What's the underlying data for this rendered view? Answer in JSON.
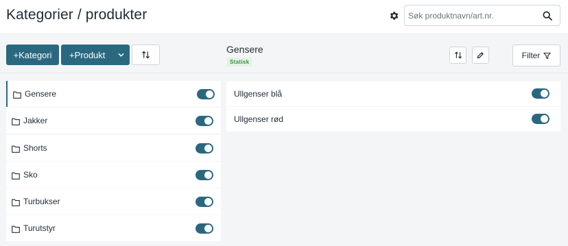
{
  "header": {
    "title": "Kategorier / produkter",
    "settings_icon": "gear-icon",
    "search": {
      "placeholder": "Søk produktnavn/art.nr.",
      "value": "",
      "icon": "search-icon"
    }
  },
  "toolbar": {
    "add_category_label": "+Kategori",
    "add_product_label": "+Produkt",
    "sort_icon": "sort-arrows-icon",
    "selected_category": {
      "name": "Gensere",
      "badge": "Statisk"
    },
    "edit_icon": "pencil-icon",
    "filter_label": "Filter",
    "filter_icon": "funnel-icon"
  },
  "categories": [
    {
      "label": "Gensere",
      "enabled": true,
      "active": true
    },
    {
      "label": "Jakker",
      "enabled": true
    },
    {
      "label": "Shorts",
      "enabled": true
    },
    {
      "label": "Sko",
      "enabled": true
    },
    {
      "label": "Turbukser",
      "enabled": true
    },
    {
      "label": "Turutstyr",
      "enabled": true
    }
  ],
  "products": [
    {
      "label": "Ullgenser blå",
      "enabled": true
    },
    {
      "label": "Ullgenser rød",
      "enabled": true
    }
  ],
  "colors": {
    "accent": "#2a6880",
    "badge_text": "#3a8e43",
    "badge_bg": "#e4f3e5"
  }
}
